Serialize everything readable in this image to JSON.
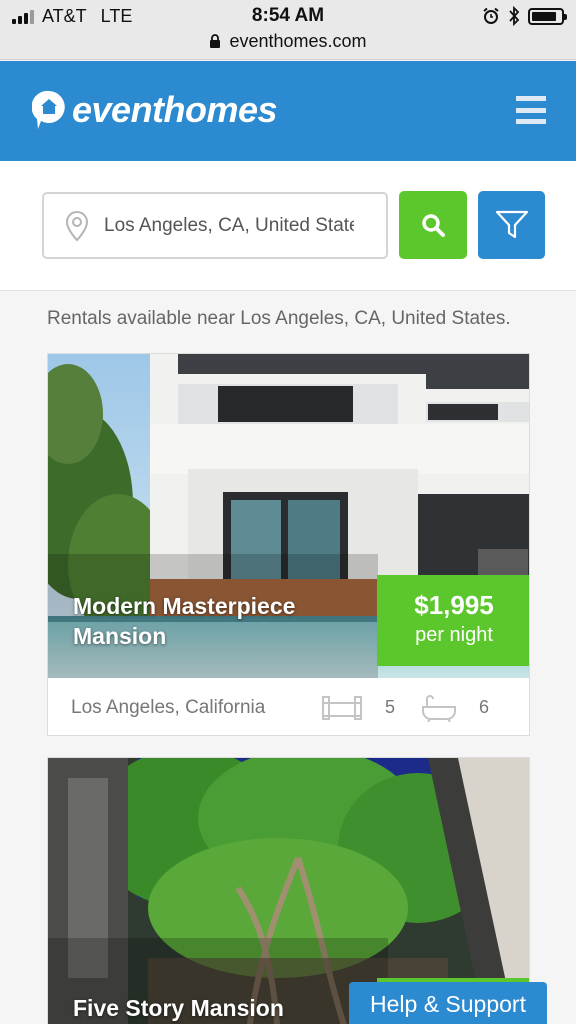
{
  "status_bar": {
    "carrier": "AT&T",
    "network": "LTE",
    "time": "8:54 AM",
    "url": "eventhomes.com",
    "signal_bars_filled": 3,
    "signal_bars_total": 4,
    "battery_level": 0.85
  },
  "header": {
    "brand": "eventhomes",
    "brand_color": "#2b8ad0"
  },
  "search": {
    "value": "Los Angeles, CA, United States",
    "search_button_color": "#5cc72c",
    "filter_button_color": "#2b8ad0"
  },
  "results_summary": "Rentals available near Los Angeles, CA, United States.",
  "listings": [
    {
      "title": "Modern Masterpiece Mansion",
      "price": "$1,995",
      "price_unit": "per night",
      "location": "Los Angeles, California",
      "bedrooms": "5",
      "bathrooms": "6"
    },
    {
      "title": "Five Story Mansion"
    }
  ],
  "help_button": "Help & Support",
  "icons": [
    "lock-icon",
    "alarm-icon",
    "bluetooth-icon",
    "battery-icon",
    "logo-icon",
    "menu-icon",
    "location-pin-icon",
    "search-icon",
    "filter-icon",
    "bed-icon",
    "bath-icon"
  ]
}
